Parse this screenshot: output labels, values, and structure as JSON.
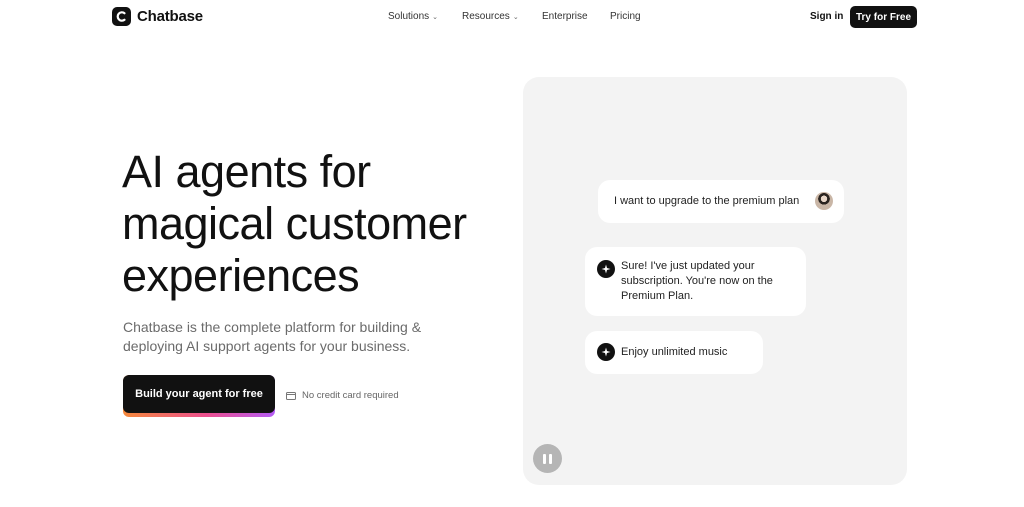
{
  "header": {
    "brand": "Chatbase",
    "nav": [
      {
        "label": "Solutions",
        "has_dropdown": true
      },
      {
        "label": "Resources",
        "has_dropdown": true
      },
      {
        "label": "Enterprise",
        "has_dropdown": false
      },
      {
        "label": "Pricing",
        "has_dropdown": false
      }
    ],
    "chevron": "⌄",
    "signin_label": "Sign in",
    "cta_label": "Try for Free"
  },
  "hero": {
    "title_lines": [
      "AI agents for",
      "magical customer",
      "experiences"
    ],
    "subtitle_lines": [
      "Chatbase is the complete platform for building &",
      "deploying AI support agents for your business."
    ],
    "cta_label": "Build your agent for free",
    "note": "No credit card required"
  },
  "chat": {
    "user_message": "I want to upgrade to the premium plan",
    "bot_message_1_lines": [
      "Sure! I've just updated your",
      "subscription. You're now on the",
      "Premium Plan."
    ],
    "bot_message_2": "Enjoy unlimited music"
  },
  "colors": {
    "accent_dark": "#111111",
    "panel_bg": "#f3f3f3",
    "cta_gradient": [
      "#f5893b",
      "#ec4f8f",
      "#b45cf5"
    ]
  },
  "icons": [
    "chatbase-logo-icon",
    "chevron-down-icon",
    "credit-card-icon",
    "user-avatar",
    "sparkle-icon",
    "pause-icon"
  ]
}
